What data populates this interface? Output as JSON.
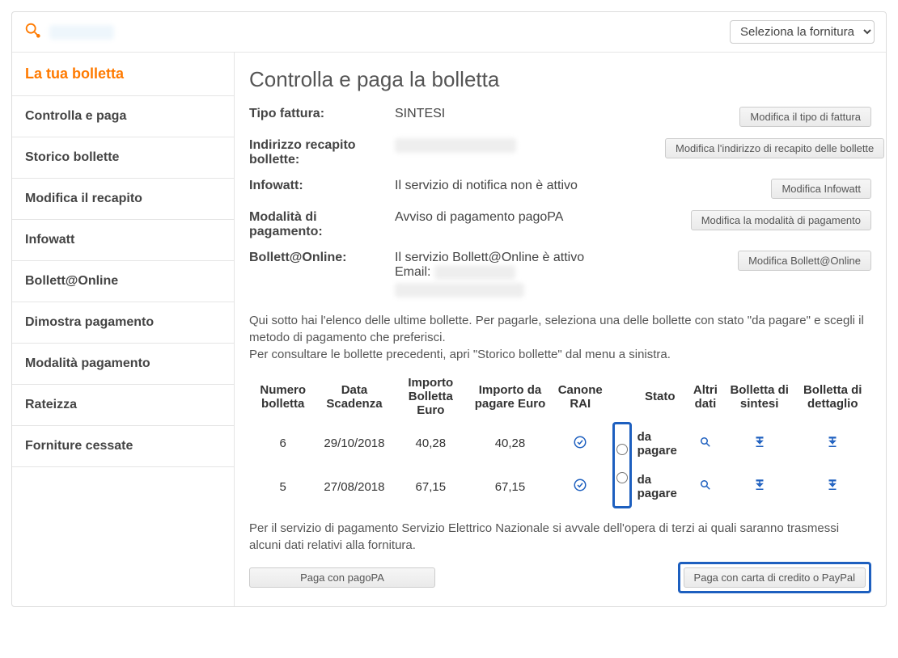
{
  "topbar": {
    "supply_select": "Seleziona la fornitura"
  },
  "sidebar": {
    "items": [
      {
        "label": "La tua bolletta",
        "active": true
      },
      {
        "label": "Controlla e paga"
      },
      {
        "label": "Storico bollette"
      },
      {
        "label": "Modifica il recapito"
      },
      {
        "label": "Infowatt"
      },
      {
        "label": "Bollett@Online"
      },
      {
        "label": "Dimostra pagamento"
      },
      {
        "label": "Modalità pagamento"
      },
      {
        "label": "Rateizza"
      },
      {
        "label": "Forniture cessate"
      }
    ]
  },
  "main": {
    "title": "Controlla e paga la bolletta",
    "rows": {
      "tipo_fattura": {
        "label": "Tipo fattura:",
        "value": "SINTESI",
        "button": "Modifica il tipo di fattura"
      },
      "indirizzo": {
        "label": "Indirizzo recapito bollette:",
        "button": "Modifica l'indirizzo di recapito delle bollette"
      },
      "infowatt": {
        "label": "Infowatt:",
        "value": "Il servizio di notifica non è attivo",
        "button": "Modifica Infowatt"
      },
      "modalita": {
        "label": "Modalità di pagamento:",
        "value": "Avviso di pagamento pagoPA",
        "button": "Modifica la modalità di pagamento"
      },
      "bollett": {
        "label": "Bollett@Online:",
        "value": "Il servizio Bollett@Online è attivo",
        "email_label": "Email:",
        "button": "Modifica Bollett@Online"
      }
    },
    "desc1": "Qui sotto hai l'elenco delle ultime bollette. Per pagarle, seleziona una delle bollette con stato \"da pagare\" e scegli il metodo di pagamento che preferisci.",
    "desc2": "Per consultare le bollette precedenti, apri \"Storico bollette\" dal menu a sinistra.",
    "table": {
      "headers": {
        "numero": "Numero bolletta",
        "scadenza": "Data Scadenza",
        "importo": "Importo Bolletta Euro",
        "da_pagare": "Importo da pagare Euro",
        "rai": "Canone RAI",
        "stato": "Stato",
        "altri": "Altri dati",
        "sintesi": "Bolletta di sintesi",
        "dettaglio": "Bolletta di dettaglio"
      },
      "rows": [
        {
          "numero": "6",
          "scadenza": "29/10/2018",
          "importo": "40,28",
          "da_pagare": "40,28",
          "stato": "da pagare"
        },
        {
          "numero": "5",
          "scadenza": "27/08/2018",
          "importo": "67,15",
          "da_pagare": "67,15",
          "stato": "da pagare"
        }
      ]
    },
    "footer_note": "Per il servizio di pagamento Servizio Elettrico Nazionale si avvale dell'opera di terzi ai quali saranno trasmessi alcuni dati relativi alla fornitura.",
    "pay_pagopa": "Paga con pagoPA",
    "pay_card": "Paga con carta di credito o PayPal"
  }
}
